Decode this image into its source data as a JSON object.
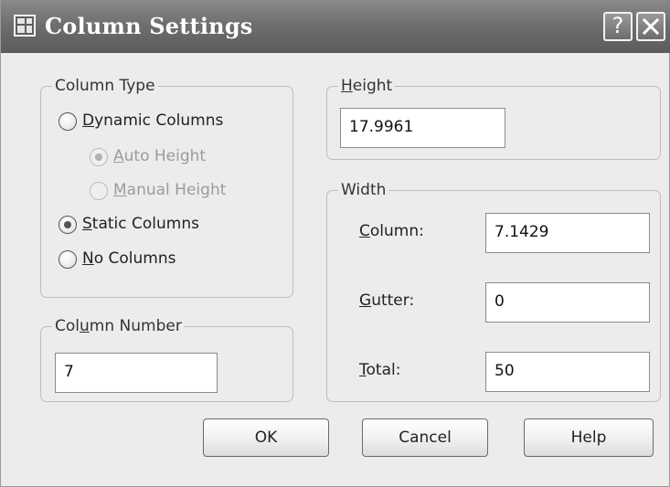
{
  "window": {
    "title": "Column Settings",
    "help_glyph": "?",
    "icon": "column-settings-app-icon"
  },
  "column_type": {
    "legend": "Column Type",
    "options": [
      {
        "label": "Dynamic Columns",
        "mnemonic": "D",
        "rest": "ynamic Columns",
        "selected": false,
        "enabled": true
      },
      {
        "label": "Auto Height",
        "mnemonic": "A",
        "rest": "uto Height",
        "selected": true,
        "enabled": false
      },
      {
        "label": "Manual Height",
        "mnemonic": "M",
        "rest": "anual Height",
        "selected": false,
        "enabled": false
      },
      {
        "label": "Static Columns",
        "mnemonic": "S",
        "rest": "tatic Columns",
        "selected": true,
        "enabled": true
      },
      {
        "label": "No Columns",
        "mnemonic": "N",
        "rest": "o Columns",
        "selected": false,
        "enabled": true
      }
    ]
  },
  "column_number": {
    "legend_pre": "Col",
    "legend_mnemonic": "u",
    "legend_post": "mn Number",
    "value": "7"
  },
  "height": {
    "legend_mnemonic": "H",
    "legend_rest": "eight",
    "value": "17.9961"
  },
  "width": {
    "legend": "Width",
    "column": {
      "mnemonic": "C",
      "rest": "olumn:",
      "value": "7.1429"
    },
    "gutter": {
      "mnemonic": "G",
      "rest": "utter:",
      "value": "0"
    },
    "total": {
      "mnemonic": "T",
      "rest": "otal:",
      "value": "50"
    }
  },
  "buttons": {
    "ok": "OK",
    "cancel": "Cancel",
    "help": "Help"
  }
}
